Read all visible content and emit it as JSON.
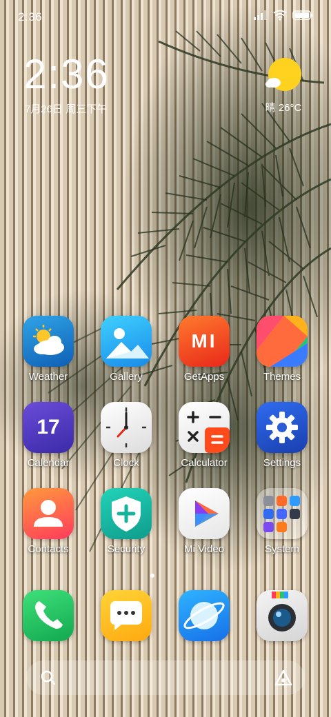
{
  "status_bar": {
    "time": "2:36",
    "icons": [
      "signal-icon",
      "wifi-icon",
      "battery-icon"
    ]
  },
  "lock_widget": {
    "clock": "2:36",
    "date": "7月26日 周三下午"
  },
  "weather": {
    "icon": "sun-cloud-icon",
    "text": "晴 26°C"
  },
  "apps": [
    {
      "label": "Weather"
    },
    {
      "label": "Gallery"
    },
    {
      "label": "GetApps"
    },
    {
      "label": "Themes"
    },
    {
      "label": "Calendar",
      "badge_text": "17"
    },
    {
      "label": "Clock"
    },
    {
      "label": "Calculator"
    },
    {
      "label": "Settings"
    },
    {
      "label": "Contacts"
    },
    {
      "label": "Security"
    },
    {
      "label": "Mi Video"
    },
    {
      "label": "System"
    }
  ],
  "getapps_logo_text": "MI",
  "dock": [
    {
      "name": "phone-app",
      "icon": "phone-icon"
    },
    {
      "name": "messages-app",
      "icon": "message-icon"
    },
    {
      "name": "browser-app",
      "icon": "planet-icon"
    },
    {
      "name": "camera-app",
      "icon": "camera-icon"
    }
  ],
  "search_bar": {
    "left_icon": "search-icon",
    "right_icon": "assistant-icon"
  },
  "pager": {
    "current_page": 1
  },
  "colors": {
    "text": "#ffffff",
    "weather_sun": "#ffd21f",
    "getapps_red": "#ff5a1f",
    "settings_blue": "#1e4fd6"
  }
}
